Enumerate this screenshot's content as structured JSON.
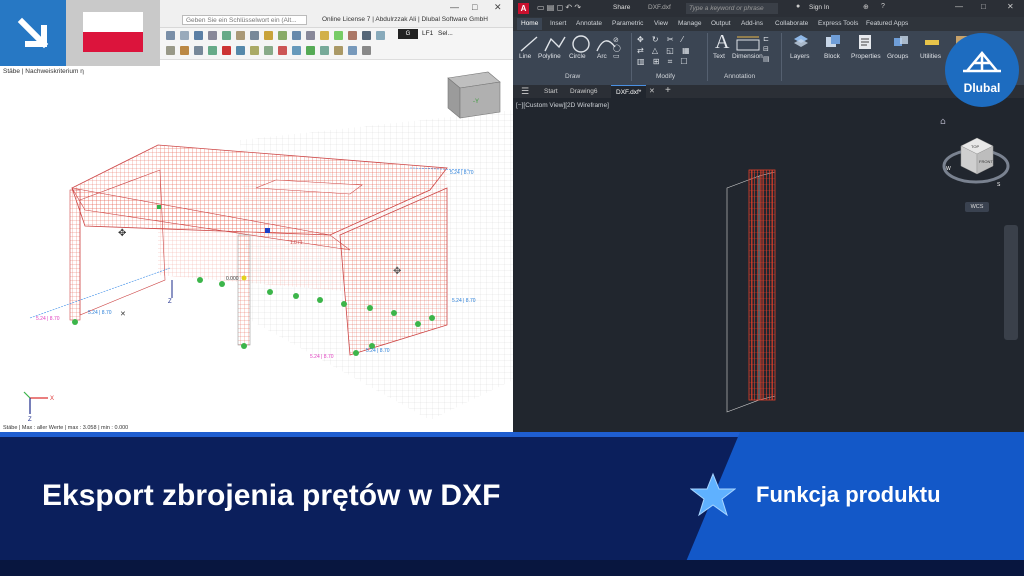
{
  "left_app": {
    "search_placeholder": "Geben Sie ein Schlüsselwort ein (Alt...",
    "license_text": "Online License 7 | Abdulrzzak Ali | Dlubal Software GmbH",
    "lf_box": "G",
    "lf_label": "LF1",
    "sel_label": "Sel...",
    "subtitle_1": "",
    "subtitle_2": "Stäbe | Nachweiskriterium η",
    "status_text": "Stäbe | Max : aller Werte | max : 3.058 | min : 0.000",
    "view_cube_label": "-Y",
    "axis_x": "X",
    "axis_z": "Z",
    "model_labels": [
      "5.24 | 8.70",
      "5.24 | 8.70",
      "5.24 | 8.70",
      "5.24 | 8.70",
      "5.24 | 8.70",
      "5.24 | 8.70",
      "1.871",
      "0.000",
      "Z"
    ]
  },
  "right_app": {
    "logo_letter": "A",
    "share_label": "Share",
    "file_label": "DXF.dxf",
    "search_placeholder": "Type a keyword or phrase",
    "signin_label": "Sign In",
    "ribbon_tabs": [
      "Home",
      "Insert",
      "Annotate",
      "Parametric",
      "View",
      "Manage",
      "Output",
      "Add-ins",
      "Collaborate",
      "Express Tools",
      "Featured Apps"
    ],
    "draw_tools": [
      "Line",
      "Polyline",
      "Circle",
      "Arc"
    ],
    "annotation_tools": [
      "Text",
      "Dimension"
    ],
    "big_tools": [
      "Layers",
      "Block",
      "Properties",
      "Groups",
      "Utilities"
    ],
    "groups": [
      "Draw",
      "Modify",
      "Annotation"
    ],
    "file_tabs": [
      "Start",
      "Drawing6",
      "DXF.dxf*"
    ],
    "view_label": "[−][Custom View][2D Wireframe]",
    "wcs": "WCS",
    "cube_top": "TOP",
    "cube_front": "FRONT",
    "compass_w": "W",
    "compass_s": "S"
  },
  "logo": {
    "name": "Dlubal"
  },
  "banner": {
    "title": "Eksport zbrojenia prętów w DXF",
    "tag": "Funkcja produktu"
  },
  "colors": {
    "banner_dark": "#0b1f5c",
    "banner_blue": "#1358c8",
    "badge_blue": "#2778c4",
    "flag_white": "#ffffff",
    "flag_red": "#dc143c",
    "rebar_red": "#e8402a"
  }
}
